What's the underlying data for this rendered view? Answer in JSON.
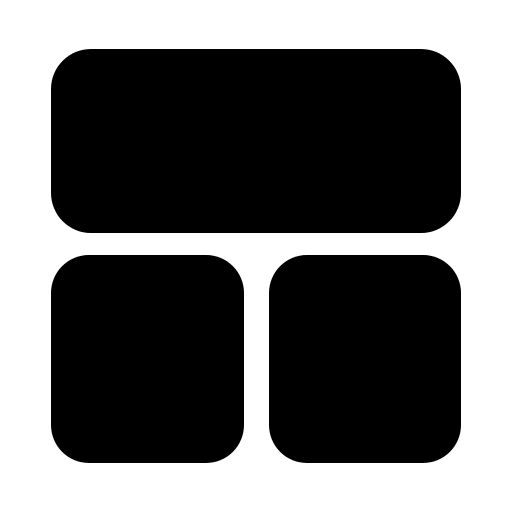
{
  "icon": {
    "name": "dashboard-layout-icon",
    "fill_color": "#000000",
    "background_color": "#ffffff",
    "tiles": [
      {
        "name": "top-wide-tile"
      },
      {
        "name": "bottom-left-tile"
      },
      {
        "name": "bottom-right-tile"
      }
    ]
  }
}
